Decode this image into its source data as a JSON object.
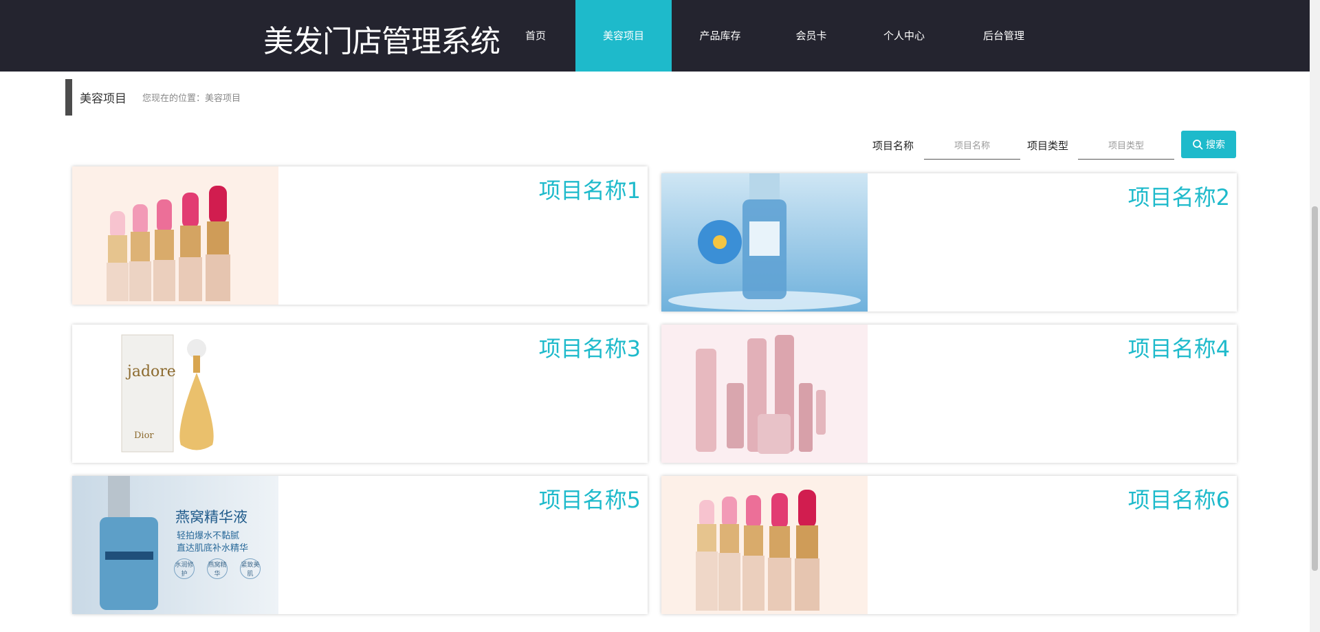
{
  "header": {
    "title": "美发门店管理系统",
    "nav": [
      {
        "label": "首页",
        "active": false
      },
      {
        "label": "美容项目",
        "active": true
      },
      {
        "label": "产品库存",
        "active": false
      },
      {
        "label": "会员卡",
        "active": false
      },
      {
        "label": "个人中心",
        "active": false
      },
      {
        "label": "后台管理",
        "active": false
      }
    ]
  },
  "breadcrumb": {
    "title": "美容项目",
    "location": "您现在的位置：美容项目"
  },
  "search": {
    "name_label": "项目名称",
    "name_placeholder": "项目名称",
    "type_label": "项目类型",
    "type_placeholder": "项目类型",
    "button_label": "搜索"
  },
  "cards": [
    {
      "title": "项目名称1",
      "image": "lipsticks"
    },
    {
      "title": "项目名称2",
      "image": "serum-bottle-water"
    },
    {
      "title": "项目名称3",
      "image": "perfume-bottle"
    },
    {
      "title": "项目名称4",
      "image": "pink-cosmetics-set"
    },
    {
      "title": "项目名称5",
      "image": "essence-ad",
      "ad_text": {
        "headline": "燕窝精华液",
        "line1": "轻拍爆水不黏腻",
        "line2": "直达肌底补水精华",
        "badge1": "水润修护",
        "badge2": "燕窝精华",
        "badge3": "紧致美肌"
      }
    },
    {
      "title": "项目名称6",
      "image": "lipsticks"
    }
  ],
  "colors": {
    "header_bg": "#24242f",
    "accent": "#1ebacb"
  }
}
